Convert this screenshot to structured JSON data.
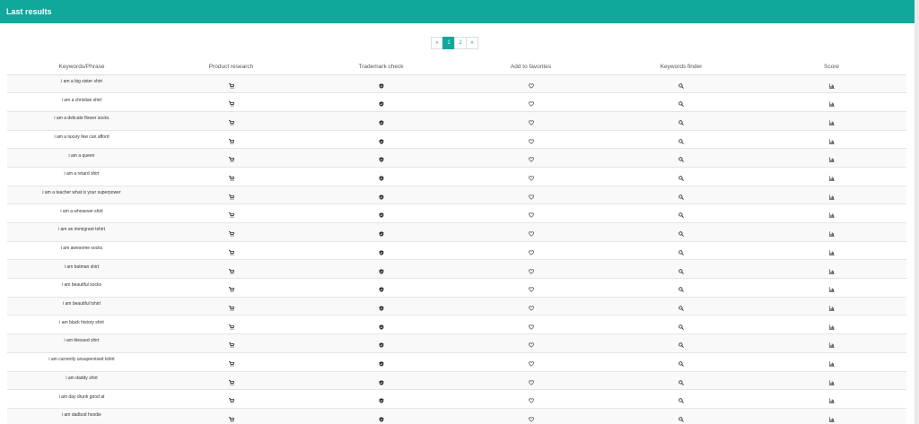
{
  "header": {
    "title": "Last results"
  },
  "pagination": {
    "prev": "«",
    "pages": [
      "1",
      "2"
    ],
    "active": "1",
    "next": "»"
  },
  "table": {
    "columns": [
      "Keywords/Phrase",
      "Product research",
      "Trademark check",
      "Add to favorites",
      "Keywords finder",
      "Score"
    ],
    "icons": {
      "product_research": "cart-icon",
      "trademark_check": "shield-icon",
      "add_to_favorites": "heart-icon",
      "keywords_finder": "search-icon",
      "score": "bar-chart-icon"
    },
    "rows": [
      "i am a big sister shirt",
      "i am a christian shirt",
      "i am a delicate flower socks",
      "i am a luxury few can afford",
      "i am a queen",
      "i am a retard shirt",
      "i am a teacher what is your superpower",
      "i am a whosever shirt",
      "i am an immigrant tshirt",
      "i am awesome socks",
      "i am batman shirt",
      "i am beautiful socks",
      "i am beautiful tshirt",
      "i am black history shirt",
      "i am blessed shirt",
      "i am currently unsupervised tshirt",
      "i am daddy shirt",
      "i am day drunk good at",
      "i am dadbod hoodie"
    ]
  },
  "colors": {
    "accent": "#10a89a",
    "row_stripe": "#f9f9f9"
  }
}
